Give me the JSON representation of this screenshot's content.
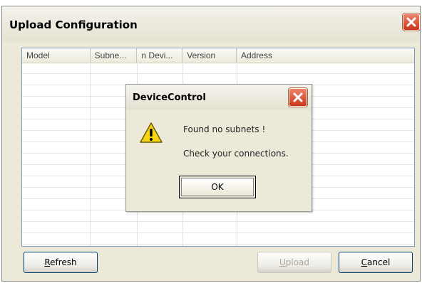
{
  "main_window": {
    "title": "Upload Configuration",
    "close_icon": "close-x-icon"
  },
  "list": {
    "columns": [
      "Model",
      "Subne...",
      "n Devi...",
      "Version",
      "Address"
    ]
  },
  "buttons": {
    "refresh_accel": "R",
    "refresh_rest": "efresh",
    "upload_accel": "U",
    "upload_rest": "pload",
    "cancel_accel": "C",
    "cancel_rest": "ancel"
  },
  "dialog": {
    "title": "DeviceControl",
    "icon": "warning-triangle-icon",
    "message_line1": "Found no subnets !",
    "message_line2": "Check your connections.",
    "ok_label": "OK"
  },
  "colors": {
    "close_button": "#d84a2a",
    "window_bg": "#ece9d8",
    "warning_yellow": "#f7d417"
  }
}
